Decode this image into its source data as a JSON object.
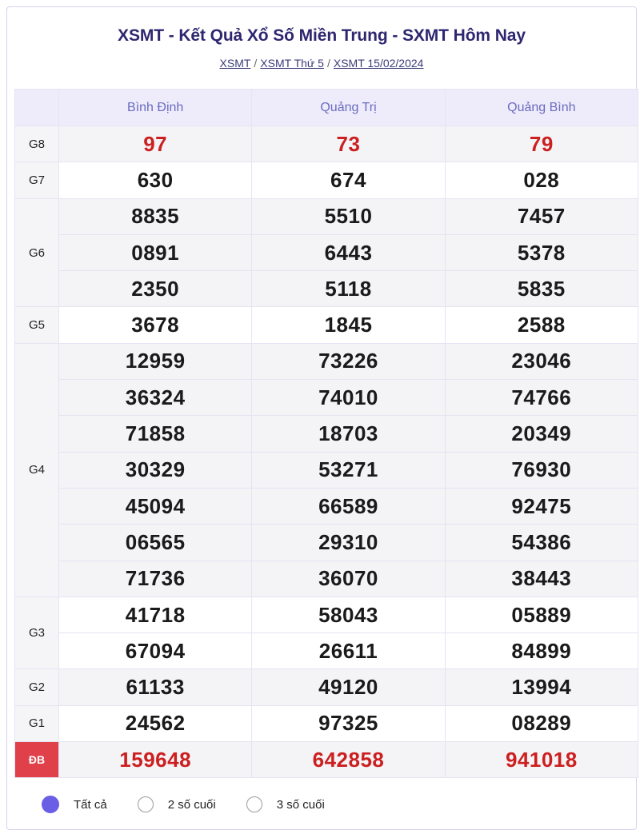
{
  "header": {
    "title": "XSMT - Kết Quả Xổ Số Miền Trung - SXMT Hôm Nay",
    "breadcrumbs": [
      "XSMT",
      "XSMT Thứ 5",
      "XSMT 15/02/2024"
    ],
    "separator": "/"
  },
  "provinces": [
    "Bình Định",
    "Quảng Trị",
    "Quảng Bình"
  ],
  "prizes": {
    "g8": {
      "label": "G8",
      "values": [
        "97",
        "73",
        "79"
      ]
    },
    "g7": {
      "label": "G7",
      "values": [
        "630",
        "674",
        "028"
      ]
    },
    "g6": {
      "label": "G6",
      "values": [
        [
          "8835",
          "5510",
          "7457"
        ],
        [
          "0891",
          "6443",
          "5378"
        ],
        [
          "2350",
          "5118",
          "5835"
        ]
      ]
    },
    "g5": {
      "label": "G5",
      "values": [
        "3678",
        "1845",
        "2588"
      ]
    },
    "g4": {
      "label": "G4",
      "values": [
        [
          "12959",
          "73226",
          "23046"
        ],
        [
          "36324",
          "74010",
          "74766"
        ],
        [
          "71858",
          "18703",
          "20349"
        ],
        [
          "30329",
          "53271",
          "76930"
        ],
        [
          "45094",
          "66589",
          "92475"
        ],
        [
          "06565",
          "29310",
          "54386"
        ],
        [
          "71736",
          "36070",
          "38443"
        ]
      ]
    },
    "g3": {
      "label": "G3",
      "values": [
        [
          "41718",
          "58043",
          "05889"
        ],
        [
          "67094",
          "26611",
          "84899"
        ]
      ]
    },
    "g2": {
      "label": "G2",
      "values": [
        "61133",
        "49120",
        "13994"
      ]
    },
    "g1": {
      "label": "G1",
      "values": [
        "24562",
        "97325",
        "08289"
      ]
    },
    "db": {
      "label": "ĐB",
      "values": [
        "159648",
        "642858",
        "941018"
      ]
    }
  },
  "filter": {
    "options": [
      "Tất cả",
      "2 số cuối",
      "3 số cuối"
    ],
    "selected": "Tất cả"
  },
  "colors": {
    "accent": "#6a5de6",
    "title": "#2d2770",
    "prize_red": "#cc1f1f",
    "special_label_bg": "#e0404a"
  }
}
